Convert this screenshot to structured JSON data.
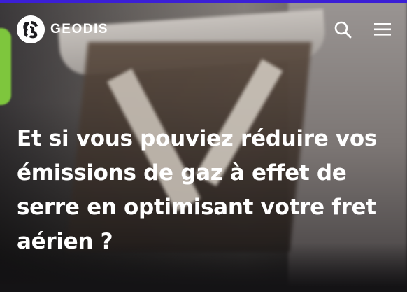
{
  "header": {
    "brand": "GEODIS",
    "icons": {
      "logo": "geodis-logo-icon",
      "search": "search-icon",
      "menu": "hamburger-menu-icon"
    }
  },
  "hero": {
    "headline": "Et si vous pouviez réduire vos émissions de gaz à effet de serre en optimisant votre fret aérien ?"
  },
  "colors": {
    "accent_stripe": "#3b1fd6",
    "text": "#ffffff"
  }
}
